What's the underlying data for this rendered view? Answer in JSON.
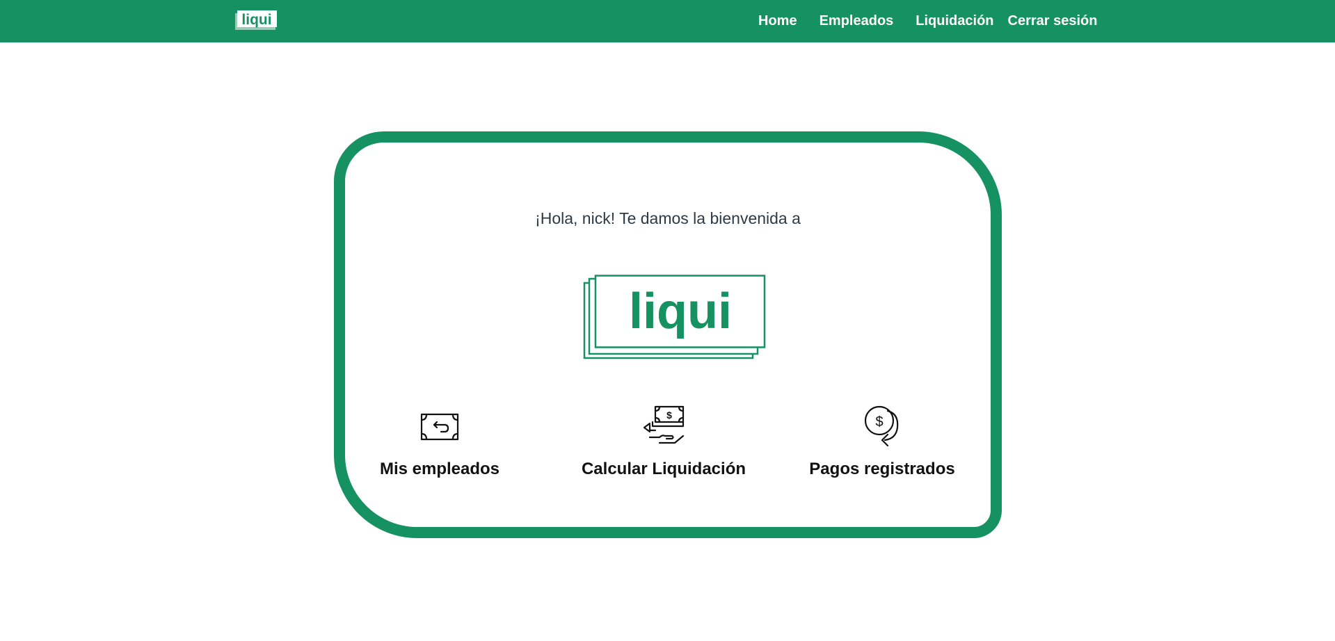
{
  "brand": {
    "name": "liqui",
    "color": "#169161"
  },
  "nav": {
    "links": [
      "Home",
      "Empleados",
      "Liquidación",
      "Cerrar sesión"
    ]
  },
  "main": {
    "welcome": "¡Hola, nick! Te damos la bienvenida a",
    "features": [
      {
        "label": "Mis empleados",
        "icon": "money-exchange-icon"
      },
      {
        "label": "Calcular Liquidación",
        "icon": "hand-cash-icon"
      },
      {
        "label": "Pagos registrados",
        "icon": "dollar-refresh-icon"
      }
    ]
  }
}
